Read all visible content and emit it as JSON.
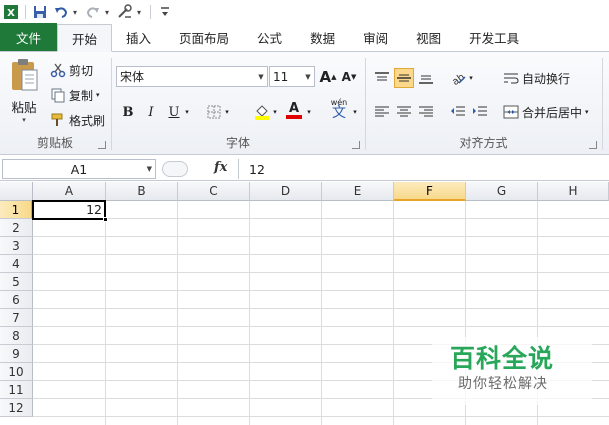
{
  "qat": {
    "icons": [
      "excel-logo-icon",
      "save-icon",
      "undo-icon",
      "redo-icon",
      "tools-icon",
      "customize-qat-icon"
    ]
  },
  "tabs": [
    {
      "label": "文件"
    },
    {
      "label": "开始"
    },
    {
      "label": "插入"
    },
    {
      "label": "页面布局"
    },
    {
      "label": "公式"
    },
    {
      "label": "数据"
    },
    {
      "label": "审阅"
    },
    {
      "label": "视图"
    },
    {
      "label": "开发工具"
    }
  ],
  "ribbon": {
    "clipboard": {
      "paste_label": "粘贴",
      "cut_label": "剪切",
      "copy_label": "复制",
      "format_painter_label": "格式刷",
      "group_label": "剪贴板"
    },
    "font": {
      "font_name": "宋体",
      "font_size": "11",
      "grow_label": "A",
      "shrink_label": "A",
      "bold_label": "B",
      "italic_label": "I",
      "underline_label": "U",
      "font_color_label": "A",
      "wen_label": "wén",
      "wen_char": "文",
      "group_label": "字体"
    },
    "alignment": {
      "wrap_text_label": "自动换行",
      "merge_center_label": "合并后居中",
      "group_label": "对齐方式"
    }
  },
  "formula_bar": {
    "name_box": "A1",
    "fx_label": "fx",
    "value": "12"
  },
  "sheet": {
    "columns": [
      "A",
      "B",
      "C",
      "D",
      "E",
      "F",
      "G",
      "H"
    ],
    "rows": [
      "1",
      "2",
      "3",
      "4",
      "5",
      "6",
      "7",
      "8",
      "9",
      "10",
      "11",
      "12"
    ],
    "active_cell_value": "12",
    "selected_column": "F"
  },
  "watermark": {
    "title": "百科全说",
    "subtitle": "助你轻松解决"
  },
  "colors": {
    "file_tab": "#1f7a3a",
    "selection_header": "#f8d98a",
    "watermark_green": "#28a75a"
  }
}
